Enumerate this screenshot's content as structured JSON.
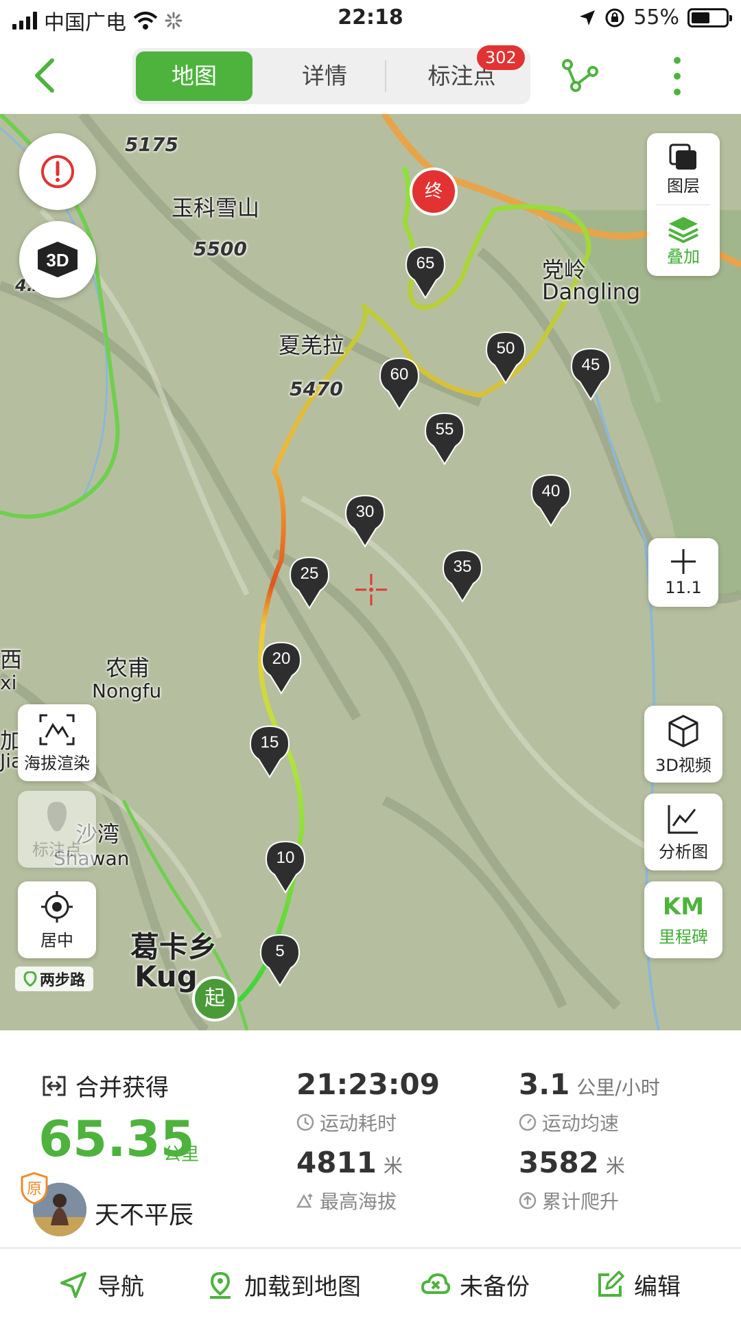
{
  "status": {
    "carrier": "中国广电",
    "time": "22:18",
    "battery": "55%",
    "battery_level": 0.55
  },
  "nav": {
    "tabs": [
      {
        "label": "地图"
      },
      {
        "label": "详情"
      },
      {
        "label": "标注点"
      }
    ],
    "badge": "302"
  },
  "map": {
    "peaks": [
      "5175",
      "5500",
      "5470",
      "4…"
    ],
    "places": {
      "yuke": "玉科雪山",
      "xiaqiang": "夏羌拉",
      "nongfu_cn": "农甫",
      "nongfu_en": "Nongfu",
      "dangling_en": "Dangling",
      "dangling_cn": "党岭",
      "shawan_cn": "沙湾",
      "shawan_en": "Shawan",
      "gekaxiang": "葛卡乡",
      "kug": "Kug",
      "xi_cn": "西",
      "xi_en": "xi",
      "jia_cn": "加",
      "jia_en": "Jiasu"
    },
    "milestones": [
      "5",
      "10",
      "15",
      "20",
      "25",
      "30",
      "35",
      "40",
      "45",
      "50",
      "55",
      "60",
      "65"
    ],
    "start_label": "起",
    "end_label": "终",
    "controls": {
      "layers_label": "图层",
      "overlay_label": "叠加",
      "zoom_label": "11.1",
      "altitude_label": "海拔渲染",
      "marker_label": "标注点",
      "center_label": "居中",
      "video3d_label": "3D视频",
      "analysis_label": "分析图",
      "km_title": "KM",
      "km_label": "里程碑",
      "logo": "两步路"
    }
  },
  "stats": {
    "merge_label": "合并获得",
    "distance": "65.35",
    "distance_unit": "公里",
    "user": "天不平辰",
    "orig_badge": "原",
    "duration": "21:23:09",
    "duration_label": "运动耗时",
    "speed": "3.1",
    "speed_unit": "公里/小时",
    "speed_label": "运动均速",
    "max_alt": "4811",
    "max_alt_unit": "米",
    "max_alt_label": "最高海拔",
    "climb": "3582",
    "climb_unit": "米",
    "climb_label": "累计爬升"
  },
  "bottom": {
    "navigate": "导航",
    "load": "加载到地图",
    "backup": "未备份",
    "edit": "编辑"
  },
  "colors": {
    "accent": "#4db33d",
    "badge": "#e23232",
    "route_low": "#5ee03a",
    "route_high": "#e0321e"
  }
}
